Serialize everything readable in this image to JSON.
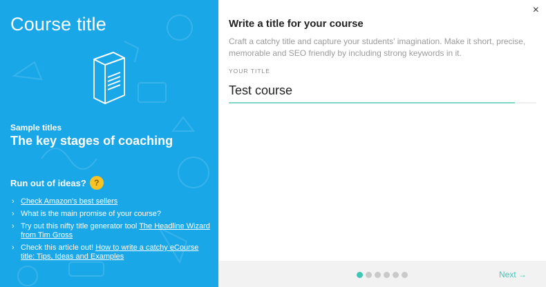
{
  "left_panel": {
    "title": "Course title",
    "sample_label": "Sample titles",
    "sample_title": "The key stages of coaching",
    "ideas_heading": "Run out of ideas?",
    "ideas": [
      {
        "prefix": "",
        "link": "Check Amazon's best sellers"
      },
      {
        "prefix": "What is the main promise of your course?",
        "link": ""
      },
      {
        "prefix": "Try out this nifty title generator tool ",
        "link": "The Headline Wizard from Tim Gross"
      },
      {
        "prefix": "Check this article out! ",
        "link": "How to write a catchy eCourse title: Tips, Ideas and Examples"
      }
    ]
  },
  "right_panel": {
    "heading": "Write a title for your course",
    "description": "Craft a catchy title and capture your students' imagination. Make it short, precise, memorable and SEO friendly by including strong keywords in it.",
    "field_label": "YOUR TITLE",
    "field_value": "Test course",
    "close_glyph": "×"
  },
  "footer": {
    "steps_total": 6,
    "active_step": 1,
    "next_label": "Next →"
  },
  "colors": {
    "panel_blue": "#1aa7e8",
    "accent_teal": "#3fc7b5",
    "underline_teal": "#7fd8c4"
  },
  "title_fill_fraction": 0.93
}
